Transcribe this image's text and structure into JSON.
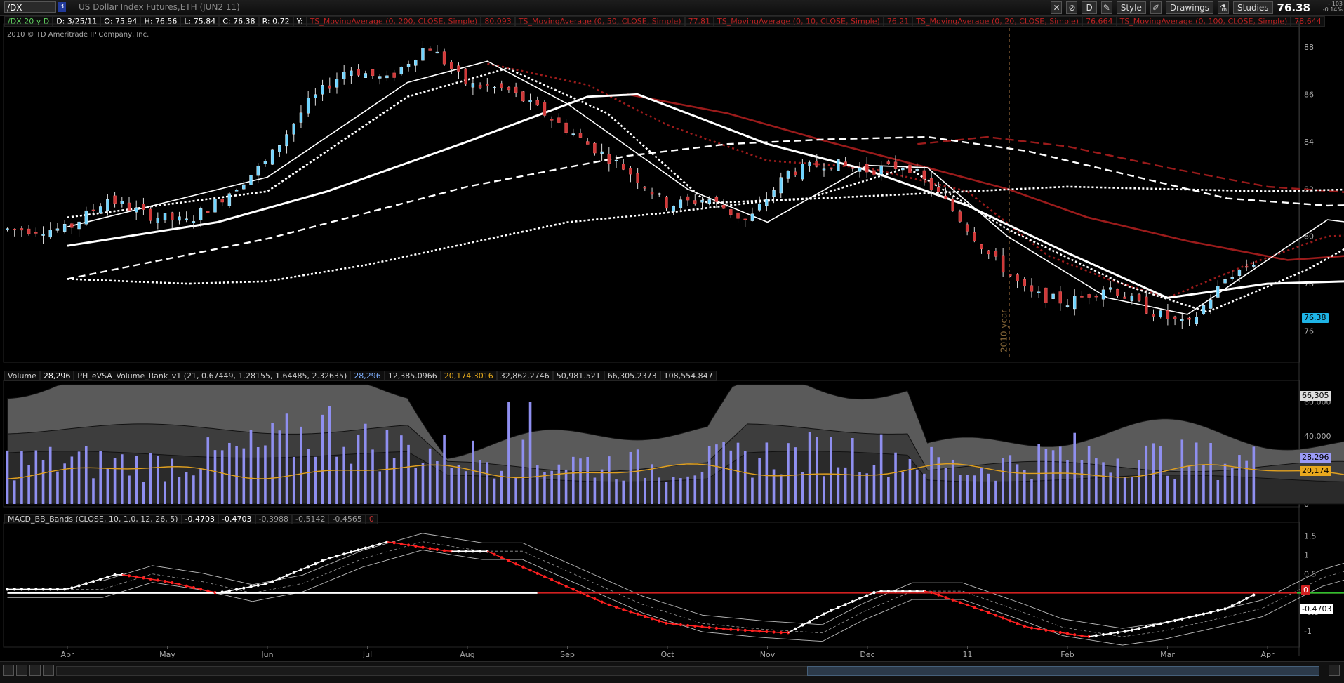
{
  "toolbar": {
    "symbol": "/DX",
    "link_number": "3",
    "description": "US Dollar Index Futures,ETH (JUN2 11)",
    "timeframe": "D",
    "style_label": "Style",
    "drawings_label": "Drawings",
    "studies_label": "Studies",
    "last_price": "76.38",
    "change_1": "-.103",
    "change_2": "-0.14%"
  },
  "price_header": {
    "aggregation": "/DX 20 y D",
    "date": "D: 3/25/11",
    "open": "O: 75.94",
    "high": "H: 76.56",
    "low": "L: 75.84",
    "close": "C: 76.38",
    "range": "R: 0.72",
    "y": "Y:",
    "ma": [
      {
        "label": "TS_MovingAverage (0, 200, CLOSE, Simple)",
        "value": "80.093"
      },
      {
        "label": "TS_MovingAverage (0, 50, CLOSE, Simple)",
        "value": "77.81"
      },
      {
        "label": "TS_MovingAverage (0, 10, CLOSE, Simple)",
        "value": "76.21"
      },
      {
        "label": "TS_MovingAverage (0, 20, CLOSE, Simple)",
        "value": "76.664"
      },
      {
        "label": "TS_MovingAverage (0, 100, CLOSE, Simple)",
        "value": "78.644"
      }
    ],
    "copyright": "2010 © TD Ameritrade IP Company, Inc."
  },
  "volume_header": {
    "label": "Volume",
    "volume": "28,296",
    "study": "PH_eVSA_Volume_Rank_v1 (21, 0.67449, 1.28155, 1.64485, 2.32635)",
    "values": [
      "28,296",
      "12,385.0966",
      "20,174.3016",
      "32,862.2746",
      "50,981.521",
      "66,305.2373",
      "108,554.847"
    ]
  },
  "macd_header": {
    "study": "MACD_BB_Bands (CLOSE, 10, 1.0, 12, 26, 5)",
    "values": [
      "-0.4703",
      "-0.4703",
      "-0.3988",
      "-0.5142",
      "-0.4565",
      "0"
    ]
  },
  "year_marker": "2010 year",
  "tags": {
    "price": "76.38",
    "vol_top": "66,305",
    "vol_cur": "28,296",
    "vol_avg": "20,174",
    "macd_zero": "0",
    "macd_cur": "-0.4703"
  },
  "colors": {
    "bull": "#6fd4ff",
    "bear": "#d03838",
    "ma_red": "#9b1b1b",
    "vol_bar": "#8f8ff0",
    "vol_avg": "#e0a020",
    "zero_line": "#d02020",
    "trend": "#e8d020"
  },
  "chart_data": [
    {
      "type": "candlestick",
      "panel": "price",
      "months": [
        "Apr",
        "May",
        "Jun",
        "Jul",
        "Aug",
        "Sep",
        "Oct",
        "Nov",
        "Dec",
        "11",
        "Feb",
        "Mar",
        "Apr"
      ],
      "y_ticks": [
        76,
        78,
        80,
        82,
        84,
        86,
        88
      ],
      "ylim": [
        74.8,
        88.8
      ],
      "close_path": [
        [
          0,
          80.3
        ],
        [
          0.4,
          81.6
        ],
        [
          0.8,
          80.9
        ],
        [
          1.2,
          80.6
        ],
        [
          1.6,
          81.8
        ],
        [
          2.0,
          83.2
        ],
        [
          2.4,
          85.6
        ],
        [
          2.8,
          87.1
        ],
        [
          3.2,
          86.6
        ],
        [
          3.6,
          88.1
        ],
        [
          4.0,
          86.4
        ],
        [
          4.4,
          86.2
        ],
        [
          4.8,
          85.1
        ],
        [
          5.2,
          83.9
        ],
        [
          5.6,
          82.8
        ],
        [
          6.0,
          81.3
        ],
        [
          6.4,
          81.6
        ],
        [
          6.8,
          80.6
        ],
        [
          7.2,
          82.7
        ],
        [
          7.6,
          83.1
        ],
        [
          8.0,
          82.8
        ],
        [
          8.4,
          83.0
        ],
        [
          8.8,
          81.4
        ],
        [
          9.2,
          79.3
        ],
        [
          9.6,
          77.6
        ],
        [
          10.0,
          77.2
        ],
        [
          10.4,
          77.9
        ],
        [
          10.8,
          76.9
        ],
        [
          11.2,
          76.2
        ],
        [
          11.6,
          78.3
        ],
        [
          12.0,
          79.2
        ],
        [
          12.4,
          80.7
        ],
        [
          12.8,
          80.6
        ],
        [
          13.2,
          80.5
        ],
        [
          13.6,
          80.1
        ],
        [
          14.0,
          79.3
        ],
        [
          14.4,
          81.0
        ],
        [
          14.8,
          79.3
        ],
        [
          15.2,
          78.4
        ],
        [
          15.6,
          77.8
        ],
        [
          16.0,
          78.2
        ],
        [
          16.4,
          76.9
        ],
        [
          16.8,
          76.6
        ],
        [
          17.2,
          77.3
        ],
        [
          17.6,
          75.8
        ],
        [
          17.95,
          76.38
        ]
      ],
      "moving_averages": [
        {
          "name": "10",
          "style": "solid-white-thin",
          "points": [
            [
              0,
              80.4
            ],
            [
              2,
              82.5
            ],
            [
              3.4,
              86.5
            ],
            [
              4.2,
              87.4
            ],
            [
              5,
              85.6
            ],
            [
              6.2,
              82.0
            ],
            [
              7,
              80.6
            ],
            [
              8,
              83.0
            ],
            [
              8.6,
              82.9
            ],
            [
              9.4,
              80.0
            ],
            [
              10.4,
              77.4
            ],
            [
              11.2,
              76.7
            ],
            [
              12,
              79.0
            ],
            [
              12.6,
              80.7
            ],
            [
              13.2,
              80.4
            ],
            [
              14,
              79.6
            ],
            [
              14.4,
              80.6
            ],
            [
              15,
              79.7
            ],
            [
              16,
              77.8
            ],
            [
              16.6,
              77.4
            ],
            [
              17.95,
              76.21
            ]
          ]
        },
        {
          "name": "20",
          "style": "dotted-white",
          "points": [
            [
              0,
              80.8
            ],
            [
              2,
              81.9
            ],
            [
              3.4,
              85.9
            ],
            [
              4.4,
              87.1
            ],
            [
              5.4,
              85.2
            ],
            [
              6.4,
              81.4
            ],
            [
              7.4,
              81.6
            ],
            [
              8.4,
              82.9
            ],
            [
              9.4,
              80.3
            ],
            [
              10.6,
              77.9
            ],
            [
              11.4,
              76.8
            ],
            [
              12.4,
              78.6
            ],
            [
              13,
              80.0
            ],
            [
              13.8,
              80.3
            ],
            [
              14.5,
              80.5
            ],
            [
              15.4,
              78.9
            ],
            [
              16.6,
              77.8
            ],
            [
              17.95,
              76.664
            ]
          ]
        },
        {
          "name": "50",
          "style": "solid-white-thick",
          "points": [
            [
              0,
              79.6
            ],
            [
              1.5,
              80.6
            ],
            [
              2.6,
              81.9
            ],
            [
              4,
              84.0
            ],
            [
              5.2,
              85.9
            ],
            [
              5.7,
              86.0
            ],
            [
              6.2,
              85.2
            ],
            [
              7,
              83.9
            ],
            [
              8,
              82.8
            ],
            [
              9,
              81.3
            ],
            [
              10,
              79.3
            ],
            [
              11,
              77.4
            ],
            [
              12,
              78.0
            ],
            [
              12.8,
              78.1
            ],
            [
              13.6,
              78.5
            ],
            [
              14.2,
              79.6
            ],
            [
              14.8,
              80.1
            ],
            [
              15.4,
              79.7
            ],
            [
              16.4,
              79.0
            ],
            [
              17.95,
              77.81
            ]
          ]
        },
        {
          "name": "100",
          "style": "dashed-white",
          "points": [
            [
              0,
              78.2
            ],
            [
              2,
              79.9
            ],
            [
              4,
              82.1
            ],
            [
              5.6,
              83.4
            ],
            [
              6.6,
              83.9
            ],
            [
              7.6,
              84.1
            ],
            [
              8.6,
              84.2
            ],
            [
              9.6,
              83.6
            ],
            [
              10.6,
              82.6
            ],
            [
              11.6,
              81.6
            ],
            [
              12.6,
              81.3
            ],
            [
              13.6,
              81.4
            ],
            [
              14.6,
              81.2
            ],
            [
              15.6,
              80.2
            ],
            [
              16.6,
              79.2
            ],
            [
              17.95,
              78.644
            ]
          ]
        },
        {
          "name": "200",
          "style": "dotted-white",
          "points": [
            [
              0,
              78.2
            ],
            [
              1.2,
              78.0
            ],
            [
              2,
              78.1
            ],
            [
              3,
              78.8
            ],
            [
              4,
              79.7
            ],
            [
              5,
              80.6
            ],
            [
              6,
              81.0
            ],
            [
              7,
              81.5
            ],
            [
              8,
              81.7
            ],
            [
              9,
              81.9
            ],
            [
              10,
              82.1
            ],
            [
              11,
              82.0
            ],
            [
              12,
              81.9
            ],
            [
              13,
              82.0
            ],
            [
              14,
              82.0
            ],
            [
              15,
              81.8
            ],
            [
              16,
              81.4
            ],
            [
              17,
              80.8
            ],
            [
              17.95,
              80.093
            ]
          ]
        }
      ],
      "red_mas": [
        {
          "name": "red-solid",
          "points": [
            [
              5.6,
              86.0
            ],
            [
              6.6,
              85.2
            ],
            [
              7.6,
              84.0
            ],
            [
              8.6,
              82.9
            ],
            [
              9.4,
              82.0
            ],
            [
              10.2,
              80.8
            ],
            [
              11.2,
              79.8
            ],
            [
              12.2,
              79.0
            ],
            [
              13.2,
              79.3
            ],
            [
              14.2,
              79.6
            ],
            [
              15,
              79.8
            ],
            [
              16,
              79.4
            ],
            [
              17,
              78.8
            ],
            [
              17.95,
              77.4
            ]
          ]
        },
        {
          "name": "red-dashed",
          "points": [
            [
              8.5,
              83.9
            ],
            [
              9.2,
              84.2
            ],
            [
              10,
              83.8
            ],
            [
              11,
              82.9
            ],
            [
              12,
              82.1
            ],
            [
              13,
              81.8
            ],
            [
              14,
              81.9
            ],
            [
              15,
              81.7
            ],
            [
              16,
              81.3
            ],
            [
              17,
              80.7
            ],
            [
              17.95,
              80.1
            ]
          ]
        },
        {
          "name": "red-dotted",
          "points": [
            [
              4.2,
              87.3
            ],
            [
              5.2,
              86.4
            ],
            [
              6,
              84.7
            ],
            [
              7,
              83.2
            ],
            [
              8,
              82.9
            ],
            [
              9,
              81.9
            ],
            [
              9.8,
              79.2
            ],
            [
              10.4,
              78.2
            ],
            [
              11,
              77.4
            ],
            [
              11.8,
              78.8
            ],
            [
              12.6,
              80.0
            ],
            [
              13.2,
              80.1
            ],
            [
              14,
              79.6
            ],
            [
              14.6,
              79.9
            ],
            [
              15.6,
              78.6
            ],
            [
              16.6,
              77.9
            ],
            [
              17.95,
              77.0
            ]
          ]
        }
      ],
      "trend_line": [
        [
          15.5,
          76.85
        ],
        [
          17.95,
          75.3
        ]
      ]
    },
    {
      "type": "bar",
      "panel": "volume",
      "y_ticks": [
        "0",
        "20,000",
        "40,000",
        "60,000"
      ],
      "ylim": [
        0,
        70000
      ],
      "profile": [
        [
          0,
          30000
        ],
        [
          1,
          28000
        ],
        [
          2,
          40000
        ],
        [
          2.6,
          55000
        ],
        [
          3,
          42000
        ],
        [
          4,
          34000
        ],
        [
          5,
          30000
        ],
        [
          6,
          26000
        ],
        [
          7,
          34000
        ],
        [
          8,
          38000
        ],
        [
          9,
          24000
        ],
        [
          10,
          36000
        ],
        [
          11,
          32000
        ],
        [
          12,
          30000
        ],
        [
          13,
          34000
        ],
        [
          14,
          28000
        ],
        [
          15,
          26000
        ],
        [
          16,
          24000
        ],
        [
          17,
          30000
        ],
        [
          17.95,
          28296
        ]
      ],
      "average": 20174
    },
    {
      "type": "line",
      "panel": "macd",
      "y_ticks": [
        -1,
        -0.5,
        0,
        0.5,
        1,
        1.5
      ],
      "ylim": [
        -1.35,
        1.75
      ],
      "points": [
        [
          0,
          0.1
        ],
        [
          0.5,
          0.5
        ],
        [
          1,
          0.3
        ],
        [
          1.5,
          0.0
        ],
        [
          2,
          0.25
        ],
        [
          2.6,
          0.9
        ],
        [
          3.2,
          1.35
        ],
        [
          3.8,
          1.1
        ],
        [
          4.2,
          1.1
        ],
        [
          4.8,
          0.4
        ],
        [
          5.4,
          -0.3
        ],
        [
          6,
          -0.8
        ],
        [
          6.6,
          -0.95
        ],
        [
          7.2,
          -1.05
        ],
        [
          7.6,
          -0.5
        ],
        [
          8.1,
          0.05
        ],
        [
          8.6,
          0.05
        ],
        [
          9.2,
          -0.5
        ],
        [
          9.6,
          -0.9
        ],
        [
          10.2,
          -1.15
        ],
        [
          10.6,
          -1.0
        ],
        [
          11.2,
          -0.65
        ],
        [
          11.6,
          -0.4
        ],
        [
          12.2,
          0.4
        ],
        [
          12.6,
          0.7
        ],
        [
          13.2,
          0.45
        ],
        [
          13.8,
          0.4
        ],
        [
          14.2,
          0.05
        ],
        [
          14.6,
          0.2
        ],
        [
          15.2,
          -0.3
        ],
        [
          15.6,
          -0.65
        ],
        [
          16.2,
          -0.2
        ],
        [
          16.6,
          -0.35
        ],
        [
          17.2,
          -0.4
        ],
        [
          17.95,
          -0.4703
        ]
      ],
      "trend_line": [
        [
          15.5,
          -0.72
        ],
        [
          18.3,
          -0.55
        ]
      ]
    }
  ]
}
